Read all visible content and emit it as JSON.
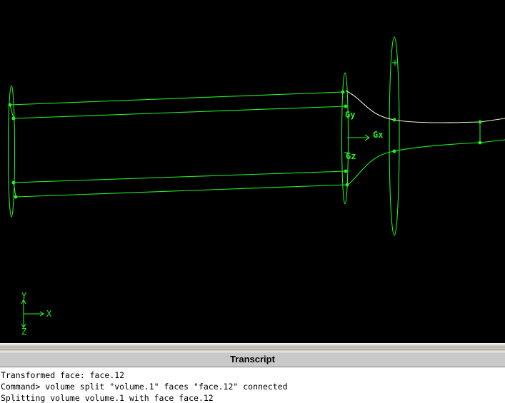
{
  "viewport": {
    "background": "#000000",
    "geometry_color": "#22ee22",
    "edge_color": "#e8f0c8",
    "center_labels": {
      "gx": "Gx",
      "gy": "Gy",
      "gz": "Gz"
    },
    "axis_triad": {
      "y": "Y",
      "x": "X",
      "z": "Z"
    }
  },
  "transcript": {
    "title": "Transcript",
    "lines": [
      "Transformed face: face.12",
      "Command> volume split \"volume.1\" faces \"face.12\" connected",
      "Splitting volume volume.1 with face face.12"
    ]
  }
}
